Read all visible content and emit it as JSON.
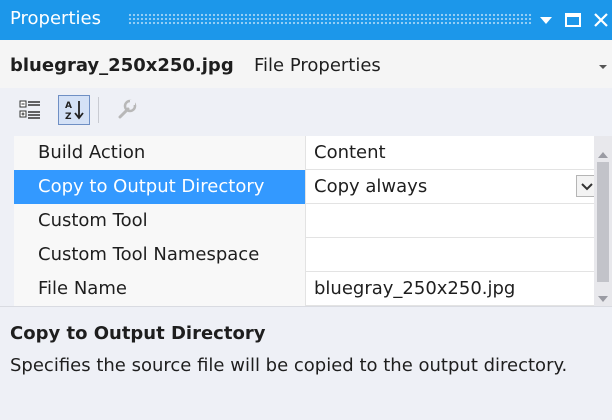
{
  "panel": {
    "title": "Properties",
    "title_buttons": [
      "dropdown-arrow",
      "maximize",
      "close"
    ]
  },
  "object": {
    "name": "bluegray_250x250.jpg",
    "type": "File Properties"
  },
  "toolbar": {
    "buttons": [
      {
        "icon": "categorized-icon",
        "pressed": false
      },
      {
        "icon": "alphabetical-icon",
        "pressed": true
      },
      {
        "icon": "property-pages-icon",
        "enabled": false
      }
    ]
  },
  "grid": {
    "rows": [
      {
        "name": "Build Action",
        "value": "Content"
      },
      {
        "name": "Copy to Output Directory",
        "value": "Copy always"
      },
      {
        "name": "Custom Tool",
        "value": ""
      },
      {
        "name": "Custom Tool Namespace",
        "value": ""
      },
      {
        "name": "File Name",
        "value": "bluegray_250x250.jpg"
      }
    ],
    "selected_index": 1
  },
  "description": {
    "title": "Copy to Output Directory",
    "text": "Specifies the source file will be copied to the output directory."
  },
  "colors": {
    "titlebar": "#1c97ea",
    "selection": "#3399ff",
    "background": "#eef0f6"
  }
}
